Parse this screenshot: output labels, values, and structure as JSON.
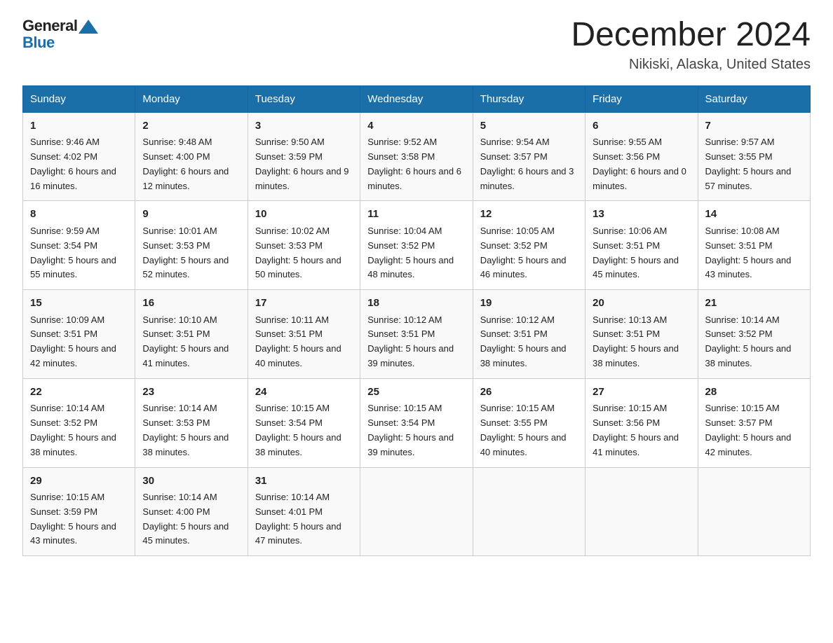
{
  "header": {
    "logo_general": "General",
    "logo_blue": "Blue",
    "month_title": "December 2024",
    "location": "Nikiski, Alaska, United States"
  },
  "days_of_week": [
    "Sunday",
    "Monday",
    "Tuesday",
    "Wednesday",
    "Thursday",
    "Friday",
    "Saturday"
  ],
  "weeks": [
    [
      {
        "day": "1",
        "sunrise": "9:46 AM",
        "sunset": "4:02 PM",
        "daylight": "6 hours and 16 minutes."
      },
      {
        "day": "2",
        "sunrise": "9:48 AM",
        "sunset": "4:00 PM",
        "daylight": "6 hours and 12 minutes."
      },
      {
        "day": "3",
        "sunrise": "9:50 AM",
        "sunset": "3:59 PM",
        "daylight": "6 hours and 9 minutes."
      },
      {
        "day": "4",
        "sunrise": "9:52 AM",
        "sunset": "3:58 PM",
        "daylight": "6 hours and 6 minutes."
      },
      {
        "day": "5",
        "sunrise": "9:54 AM",
        "sunset": "3:57 PM",
        "daylight": "6 hours and 3 minutes."
      },
      {
        "day": "6",
        "sunrise": "9:55 AM",
        "sunset": "3:56 PM",
        "daylight": "6 hours and 0 minutes."
      },
      {
        "day": "7",
        "sunrise": "9:57 AM",
        "sunset": "3:55 PM",
        "daylight": "5 hours and 57 minutes."
      }
    ],
    [
      {
        "day": "8",
        "sunrise": "9:59 AM",
        "sunset": "3:54 PM",
        "daylight": "5 hours and 55 minutes."
      },
      {
        "day": "9",
        "sunrise": "10:01 AM",
        "sunset": "3:53 PM",
        "daylight": "5 hours and 52 minutes."
      },
      {
        "day": "10",
        "sunrise": "10:02 AM",
        "sunset": "3:53 PM",
        "daylight": "5 hours and 50 minutes."
      },
      {
        "day": "11",
        "sunrise": "10:04 AM",
        "sunset": "3:52 PM",
        "daylight": "5 hours and 48 minutes."
      },
      {
        "day": "12",
        "sunrise": "10:05 AM",
        "sunset": "3:52 PM",
        "daylight": "5 hours and 46 minutes."
      },
      {
        "day": "13",
        "sunrise": "10:06 AM",
        "sunset": "3:51 PM",
        "daylight": "5 hours and 45 minutes."
      },
      {
        "day": "14",
        "sunrise": "10:08 AM",
        "sunset": "3:51 PM",
        "daylight": "5 hours and 43 minutes."
      }
    ],
    [
      {
        "day": "15",
        "sunrise": "10:09 AM",
        "sunset": "3:51 PM",
        "daylight": "5 hours and 42 minutes."
      },
      {
        "day": "16",
        "sunrise": "10:10 AM",
        "sunset": "3:51 PM",
        "daylight": "5 hours and 41 minutes."
      },
      {
        "day": "17",
        "sunrise": "10:11 AM",
        "sunset": "3:51 PM",
        "daylight": "5 hours and 40 minutes."
      },
      {
        "day": "18",
        "sunrise": "10:12 AM",
        "sunset": "3:51 PM",
        "daylight": "5 hours and 39 minutes."
      },
      {
        "day": "19",
        "sunrise": "10:12 AM",
        "sunset": "3:51 PM",
        "daylight": "5 hours and 38 minutes."
      },
      {
        "day": "20",
        "sunrise": "10:13 AM",
        "sunset": "3:51 PM",
        "daylight": "5 hours and 38 minutes."
      },
      {
        "day": "21",
        "sunrise": "10:14 AM",
        "sunset": "3:52 PM",
        "daylight": "5 hours and 38 minutes."
      }
    ],
    [
      {
        "day": "22",
        "sunrise": "10:14 AM",
        "sunset": "3:52 PM",
        "daylight": "5 hours and 38 minutes."
      },
      {
        "day": "23",
        "sunrise": "10:14 AM",
        "sunset": "3:53 PM",
        "daylight": "5 hours and 38 minutes."
      },
      {
        "day": "24",
        "sunrise": "10:15 AM",
        "sunset": "3:54 PM",
        "daylight": "5 hours and 38 minutes."
      },
      {
        "day": "25",
        "sunrise": "10:15 AM",
        "sunset": "3:54 PM",
        "daylight": "5 hours and 39 minutes."
      },
      {
        "day": "26",
        "sunrise": "10:15 AM",
        "sunset": "3:55 PM",
        "daylight": "5 hours and 40 minutes."
      },
      {
        "day": "27",
        "sunrise": "10:15 AM",
        "sunset": "3:56 PM",
        "daylight": "5 hours and 41 minutes."
      },
      {
        "day": "28",
        "sunrise": "10:15 AM",
        "sunset": "3:57 PM",
        "daylight": "5 hours and 42 minutes."
      }
    ],
    [
      {
        "day": "29",
        "sunrise": "10:15 AM",
        "sunset": "3:59 PM",
        "daylight": "5 hours and 43 minutes."
      },
      {
        "day": "30",
        "sunrise": "10:14 AM",
        "sunset": "4:00 PM",
        "daylight": "5 hours and 45 minutes."
      },
      {
        "day": "31",
        "sunrise": "10:14 AM",
        "sunset": "4:01 PM",
        "daylight": "5 hours and 47 minutes."
      },
      null,
      null,
      null,
      null
    ]
  ]
}
